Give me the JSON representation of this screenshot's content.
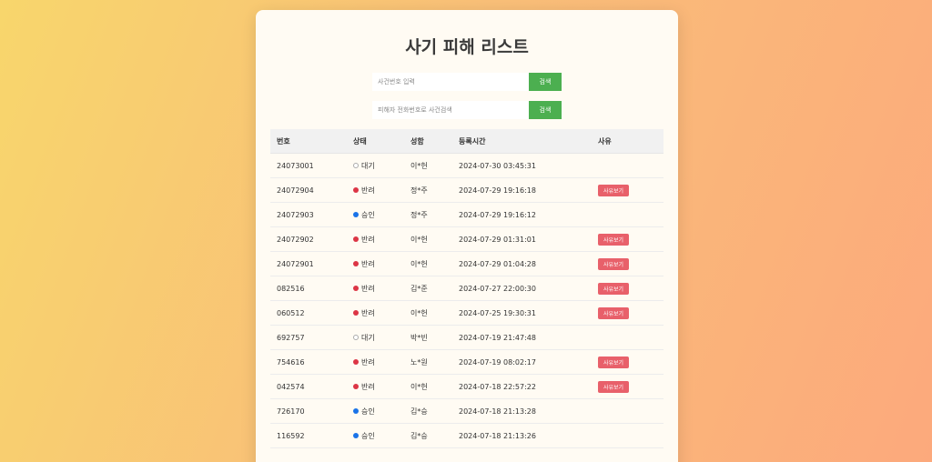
{
  "page": {
    "title": "사기 피해 리스트"
  },
  "search": {
    "case_placeholder": "사건번호 입력",
    "case_button": "검색",
    "phone_placeholder": "피해자 전화번호로 사건검색",
    "phone_button": "검색"
  },
  "status_colors": {
    "대기": "#ffffff",
    "반려": "#dc3545",
    "승인": "#1a73e8"
  },
  "table": {
    "headers": [
      "번호",
      "상태",
      "성함",
      "등록시간",
      "사유"
    ],
    "reason_button_label": "사유보기",
    "rows": [
      {
        "id": "24073001",
        "status": "대기",
        "name": "이*헌",
        "time": "2024-07-30 03:45:31",
        "has_reason": false
      },
      {
        "id": "24072904",
        "status": "반려",
        "name": "정*주",
        "time": "2024-07-29 19:16:18",
        "has_reason": true
      },
      {
        "id": "24072903",
        "status": "승인",
        "name": "정*주",
        "time": "2024-07-29 19:16:12",
        "has_reason": false
      },
      {
        "id": "24072902",
        "status": "반려",
        "name": "이*헌",
        "time": "2024-07-29 01:31:01",
        "has_reason": true
      },
      {
        "id": "24072901",
        "status": "반려",
        "name": "이*헌",
        "time": "2024-07-29 01:04:28",
        "has_reason": true
      },
      {
        "id": "082516",
        "status": "반려",
        "name": "김*준",
        "time": "2024-07-27 22:00:30",
        "has_reason": true
      },
      {
        "id": "060512",
        "status": "반려",
        "name": "이*헌",
        "time": "2024-07-25 19:30:31",
        "has_reason": true
      },
      {
        "id": "692757",
        "status": "대기",
        "name": "박*빈",
        "time": "2024-07-19 21:47:48",
        "has_reason": false
      },
      {
        "id": "754616",
        "status": "반려",
        "name": "노*원",
        "time": "2024-07-19 08:02:17",
        "has_reason": true
      },
      {
        "id": "042574",
        "status": "반려",
        "name": "이*헌",
        "time": "2024-07-18 22:57:22",
        "has_reason": true
      },
      {
        "id": "726170",
        "status": "승인",
        "name": "김*승",
        "time": "2024-07-18 21:13:28",
        "has_reason": false
      },
      {
        "id": "116592",
        "status": "승인",
        "name": "김*승",
        "time": "2024-07-18 21:13:26",
        "has_reason": false
      }
    ]
  }
}
